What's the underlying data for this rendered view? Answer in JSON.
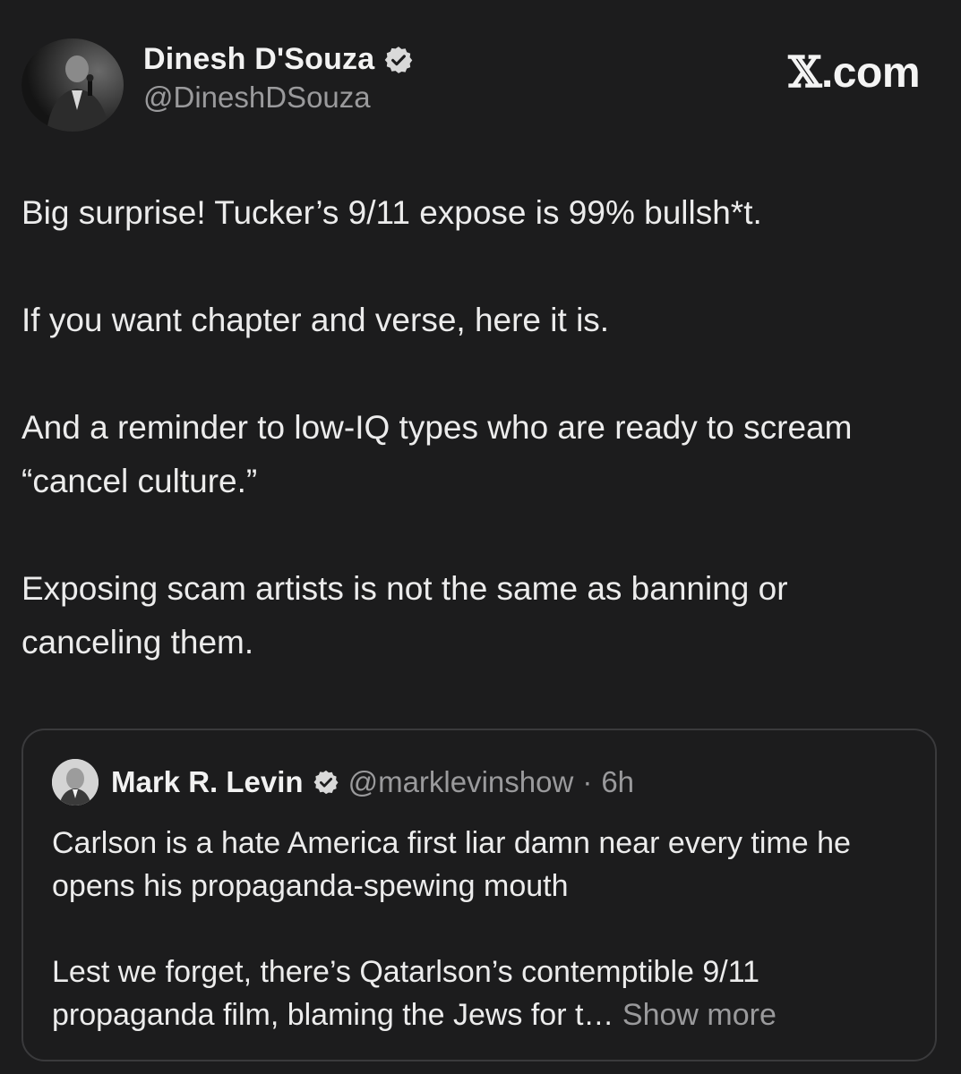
{
  "author": {
    "display_name": "Dinesh D'Souza",
    "handle": "@DineshDSouza",
    "verified": true
  },
  "site": {
    "label_glyph": "𝕏",
    "label_suffix": ".com"
  },
  "tweet": {
    "paragraphs": [
      "Big surprise! Tucker’s 9/11 expose is 99% bullsh*t.",
      "If you want chapter and verse, here it is.",
      "And a reminder to low-IQ types who are ready to scream “cancel culture.”",
      "Exposing scam artists is not the same as banning or canceling them."
    ]
  },
  "quote": {
    "display_name": "Mark R. Levin",
    "handle": "@marklevinshow",
    "separator": "·",
    "time": "6h",
    "paragraph_1": "Carlson is a hate America first liar damn near every time he opens his propaganda-spewing mouth",
    "paragraph_2": "Lest we forget, there’s Qatarlson’s contemptible 9/11 propaganda film, blaming the Jews for t…",
    "show_more": "Show more"
  },
  "colors": {
    "background": "#1c1c1d",
    "text_primary": "#ececec",
    "text_secondary": "#9a9a9c",
    "card_border": "#3a3a3c",
    "verified_badge": "#d9d9d9"
  },
  "icons": {
    "verified": "verified-badge-icon",
    "avatar": "profile-photo",
    "quote_avatar": "profile-photo"
  }
}
